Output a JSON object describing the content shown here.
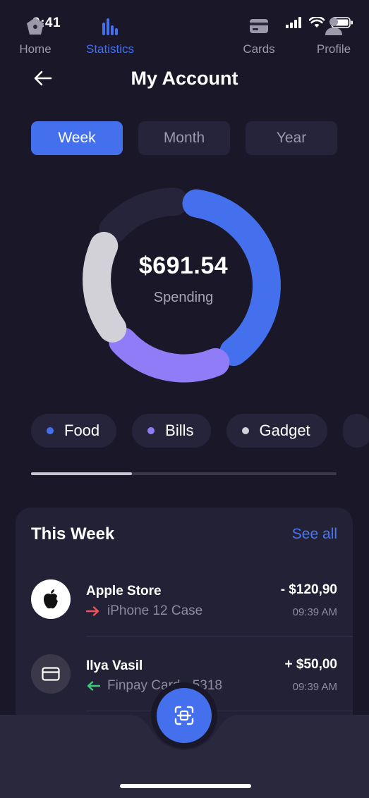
{
  "status_bar": {
    "time": "9:41"
  },
  "header": {
    "title": "My Account"
  },
  "tabs": [
    {
      "label": "Week",
      "active": true
    },
    {
      "label": "Month",
      "active": false
    },
    {
      "label": "Year",
      "active": false
    }
  ],
  "summary": {
    "amount": "$691.54",
    "caption": "Spending"
  },
  "categories": [
    {
      "label": "Food",
      "color": "#4470ee"
    },
    {
      "label": "Bills",
      "color": "#8f7cf6"
    },
    {
      "label": "Gadget",
      "color": "#d2d1d8"
    }
  ],
  "category_scroll_position": 0.33,
  "this_week": {
    "title": "This Week",
    "see_all": "See all",
    "transactions": [
      {
        "name": "Apple Store",
        "detail": "iPhone 12 Case",
        "direction": "outgoing",
        "amount": "- $120,90",
        "time": "09:39 AM",
        "icon": "apple-icon"
      },
      {
        "name": "Ilya Vasil",
        "detail": "Finpay Card • 5318",
        "direction": "incoming",
        "amount": "+ $50,00",
        "time": "09:39 AM",
        "icon": "card-icon"
      }
    ]
  },
  "nav": {
    "home": "Home",
    "statistics": "Statistics",
    "cards": "Cards",
    "profile": "Profile"
  },
  "colors": {
    "background": "#1a1828",
    "accent": "#4470ee",
    "bills": "#8f7cf6",
    "gadget": "#d2d1d8",
    "track": "#26243a",
    "outgoing": "#f0525a",
    "incoming": "#3ccb7a"
  }
}
